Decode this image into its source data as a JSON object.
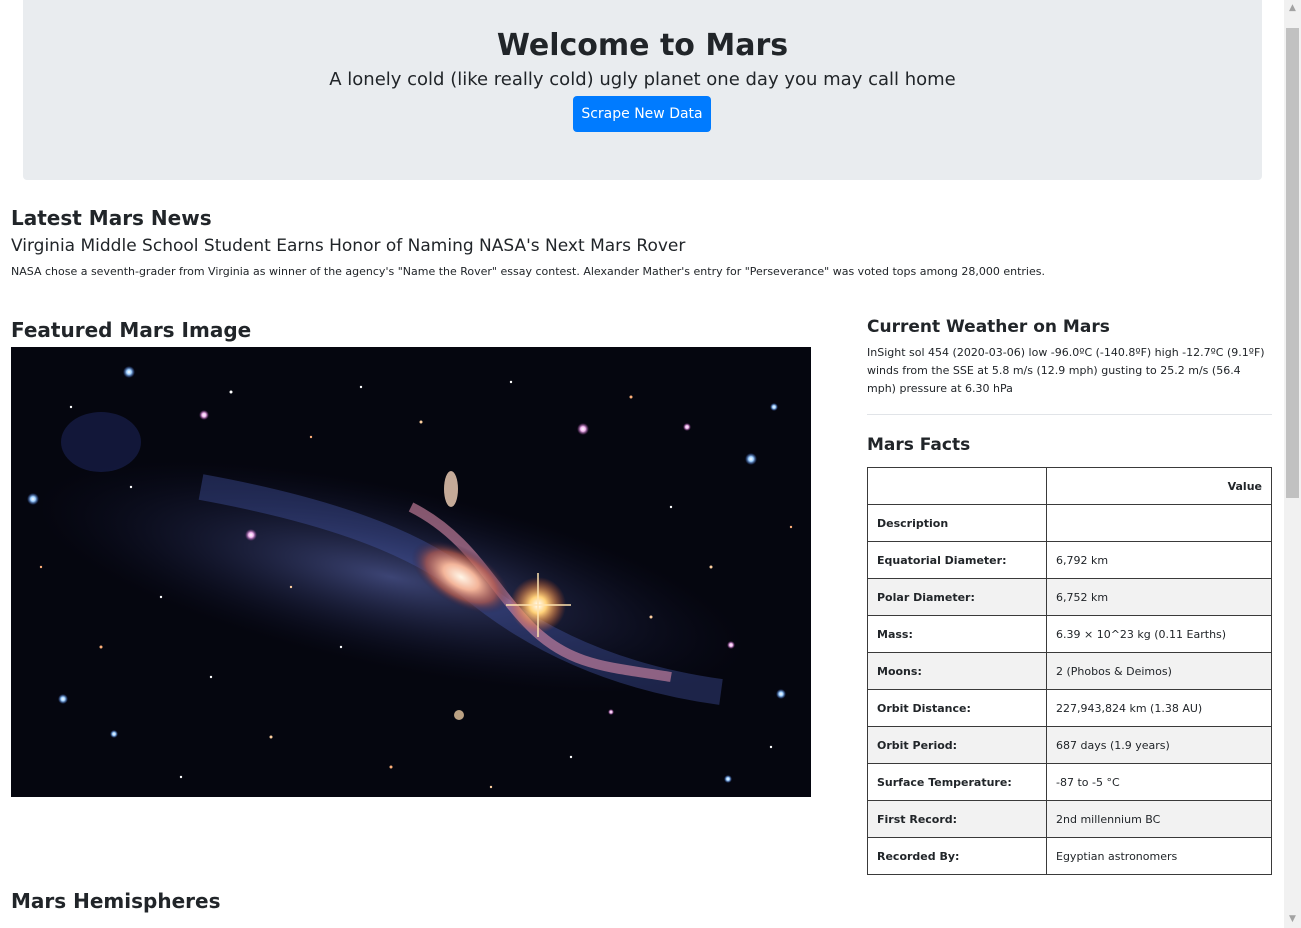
{
  "header": {
    "title": "Welcome to Mars",
    "tagline": "A lonely cold (like really cold) ugly planet one day you may call home",
    "scrape_button": "Scrape New Data"
  },
  "news": {
    "heading": "Latest Mars News",
    "title": "Virginia Middle School Student Earns Honor of Naming NASA's Next Mars Rover",
    "teaser": "NASA chose a seventh-grader from Virginia as winner of the agency's \"Name the Rover\" essay contest. Alexander Mather's entry for \"Perseverance\" was voted tops among 28,000 entries."
  },
  "featured": {
    "heading": "Featured Mars Image"
  },
  "weather": {
    "heading": "Current Weather on Mars",
    "text": "InSight sol 454 (2020-03-06) low -96.0ºC (-140.8ºF) high -12.7ºC (9.1ºF) winds from the SSE at 5.8 m/s (12.9 mph) gusting to 25.2 m/s (56.4 mph) pressure at 6.30 hPa"
  },
  "facts": {
    "heading": "Mars Facts",
    "header_value": "Value",
    "header_description": "Description",
    "rows": [
      {
        "label": "Equatorial Diameter:",
        "value": "6,792 km"
      },
      {
        "label": "Polar Diameter:",
        "value": "6,752 km"
      },
      {
        "label": "Mass:",
        "value": "6.39 × 10^23 kg (0.11 Earths)"
      },
      {
        "label": "Moons:",
        "value": "2 (Phobos & Deimos)"
      },
      {
        "label": "Orbit Distance:",
        "value": "227,943,824 km (1.38 AU)"
      },
      {
        "label": "Orbit Period:",
        "value": "687 days (1.9 years)"
      },
      {
        "label": "Surface Temperature:",
        "value": "-87 to -5 °C"
      },
      {
        "label": "First Record:",
        "value": "2nd millennium BC"
      },
      {
        "label": "Recorded By:",
        "value": "Egyptian astronomers"
      }
    ]
  },
  "hemispheres": {
    "heading": "Mars Hemispheres"
  },
  "colors": {
    "jumbotron_bg": "#e9ecef",
    "primary": "#007bff",
    "table_stripe": "#f2f2f2"
  }
}
